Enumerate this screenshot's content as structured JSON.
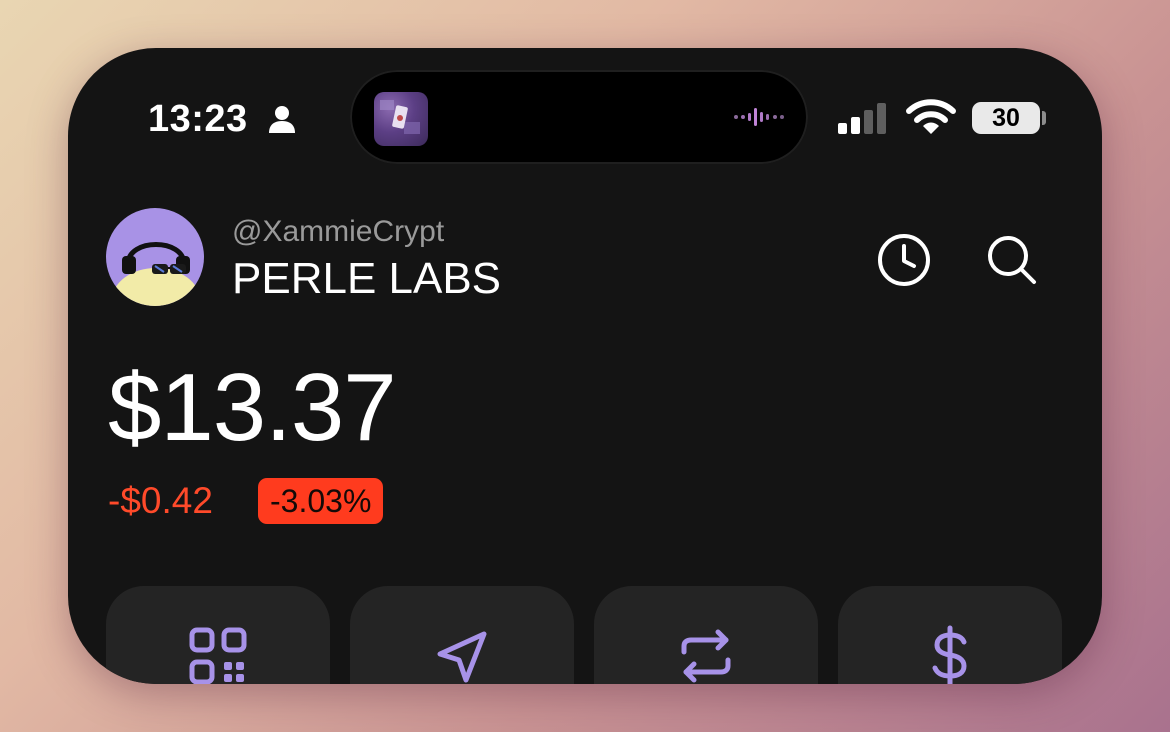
{
  "status_bar": {
    "time": "13:23",
    "battery": "30",
    "icons": [
      "person-icon",
      "signal-icon",
      "wifi-icon",
      "battery-icon"
    ]
  },
  "dynamic_island": {
    "icons": [
      "album-art-icon",
      "audio-waveform-icon"
    ]
  },
  "account": {
    "handle": "@XammieCrypt",
    "wallet_name": "PERLE LABS",
    "icons": [
      "avatar",
      "clock-icon",
      "search-icon"
    ]
  },
  "balance": {
    "amount": "$13.37",
    "change_value": "-$0.42",
    "change_percent": "-3.03%"
  },
  "actions": [
    {
      "icon": "qr-code-icon"
    },
    {
      "icon": "send-icon"
    },
    {
      "icon": "swap-icon"
    },
    {
      "icon": "dollar-icon"
    }
  ],
  "colors": {
    "background": "#141414",
    "accent": "#a792e8",
    "negative": "#ff4a2a",
    "card": "#242424"
  }
}
